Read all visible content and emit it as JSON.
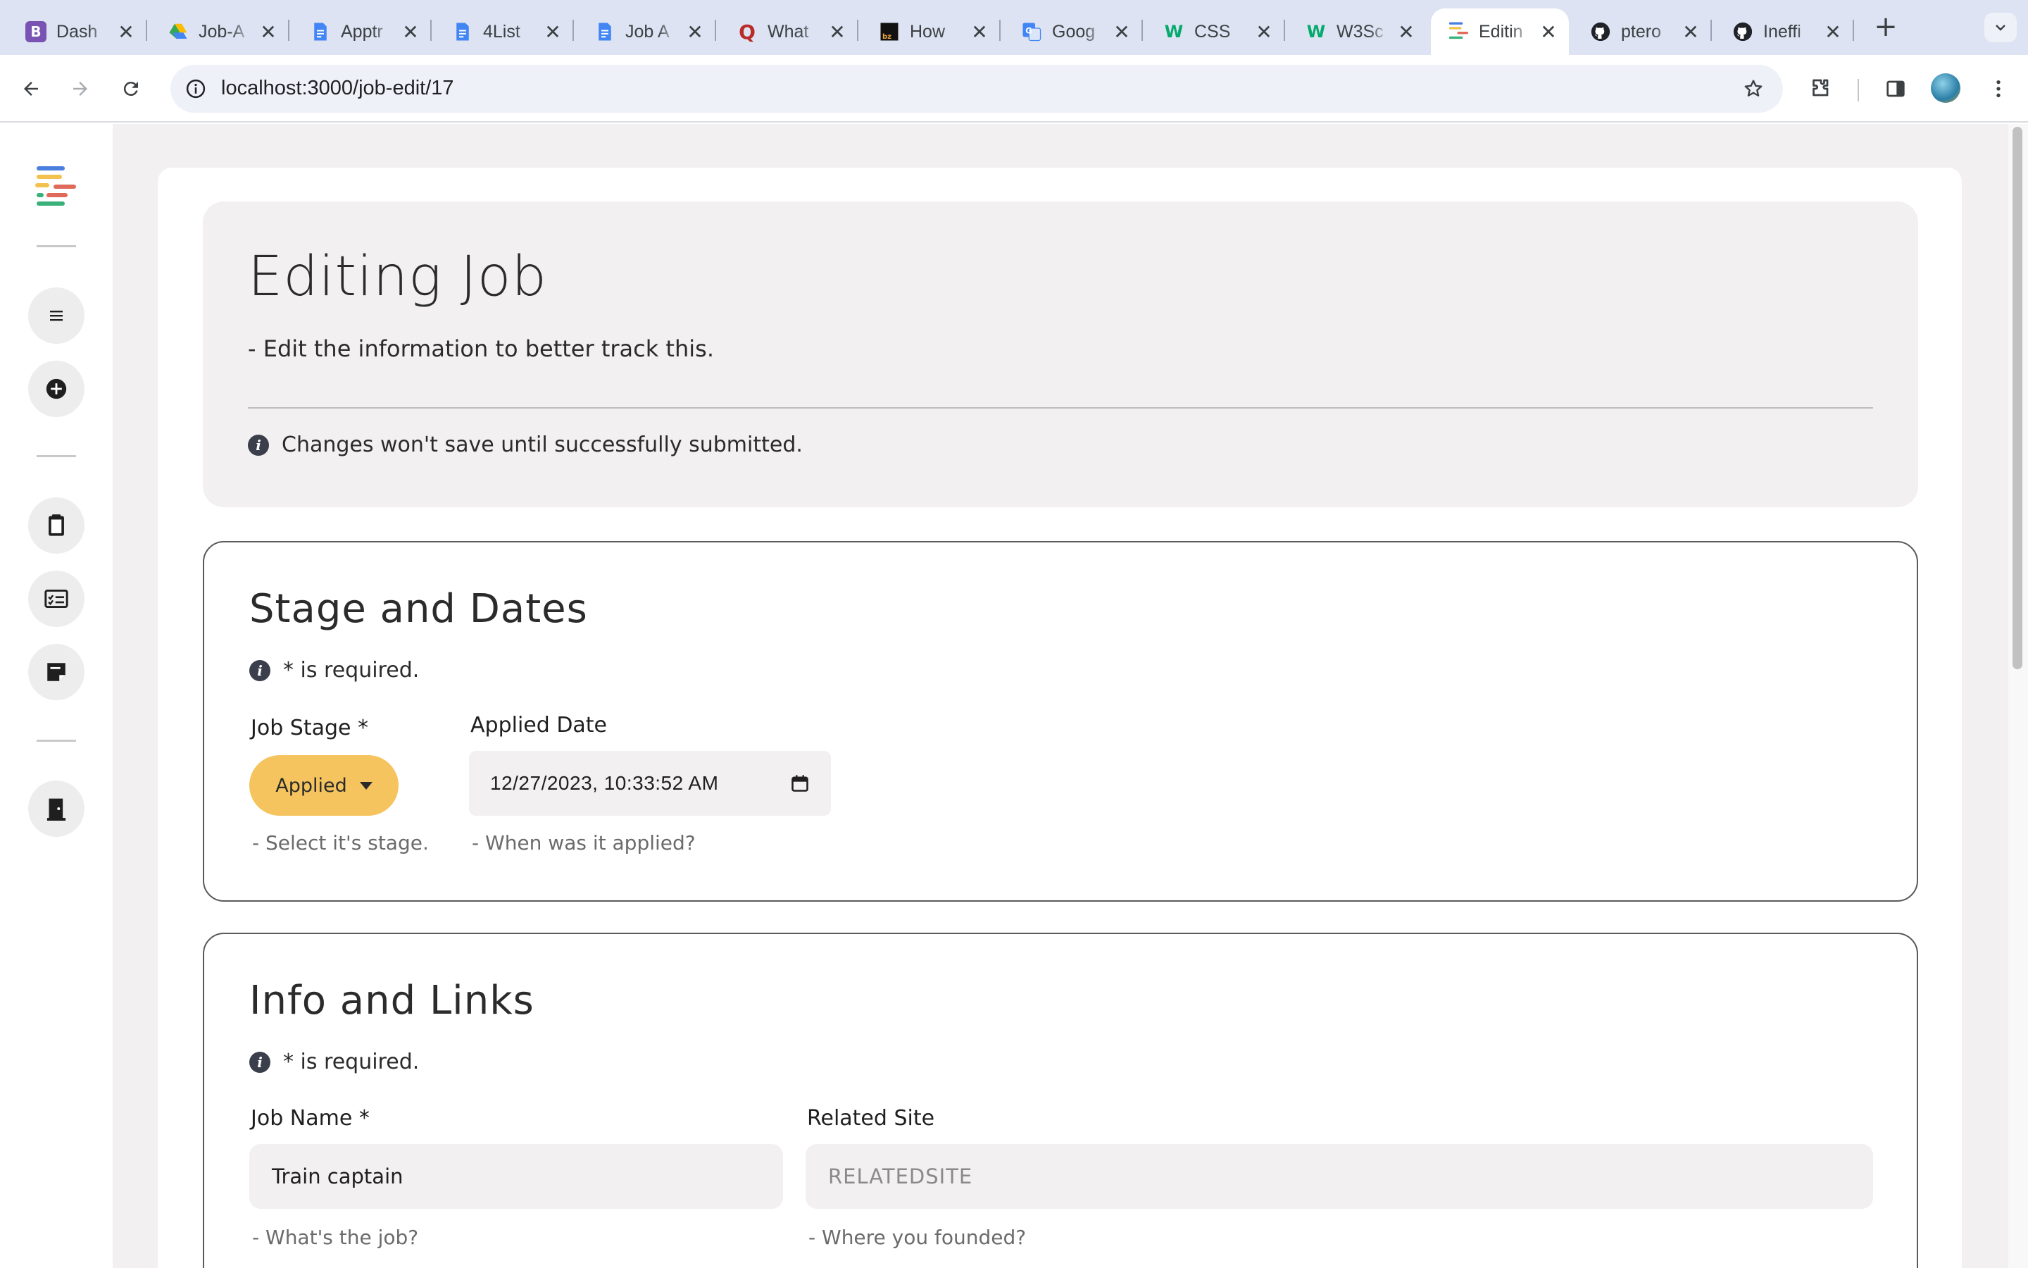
{
  "browser": {
    "tabs": [
      {
        "title": "Dash",
        "favicon": "bootstrap-icon",
        "color": "#7952b3",
        "glyph": "B"
      },
      {
        "title": "Job-A",
        "favicon": "google-drive-icon",
        "color": "#ffffff",
        "glyph": ""
      },
      {
        "title": "Apptr",
        "favicon": "google-docs-icon",
        "color": "#4285f4",
        "glyph": ""
      },
      {
        "title": "4List",
        "favicon": "google-docs-icon",
        "color": "#4285f4",
        "glyph": ""
      },
      {
        "title": "Job A",
        "favicon": "google-docs-icon",
        "color": "#4285f4",
        "glyph": ""
      },
      {
        "title": "What",
        "favicon": "quora-icon",
        "color": "#b92b27",
        "glyph": "Q"
      },
      {
        "title": "How",
        "favicon": "bytes-icon",
        "color": "#111111",
        "glyph": ""
      },
      {
        "title": "Goog",
        "favicon": "google-translate-icon",
        "color": "#4285f4",
        "glyph": "G"
      },
      {
        "title": "CSS",
        "favicon": "w3schools-icon",
        "color": "#04aa6d",
        "glyph": "W"
      },
      {
        "title": "W3Sc",
        "favicon": "w3schools-icon",
        "color": "#04aa6d",
        "glyph": "W"
      },
      {
        "title": "Editin",
        "favicon": "app-logo-icon",
        "color": "#ffffff",
        "glyph": ""
      },
      {
        "title": "ptero",
        "favicon": "github-icon",
        "color": "#ffffff",
        "glyph": ""
      },
      {
        "title": "Ineffi",
        "favicon": "github-icon",
        "color": "#ffffff",
        "glyph": ""
      }
    ],
    "active_tab_index": 10,
    "url": "localhost:3000/job-edit/17",
    "tab_close_glyph": "✕",
    "new_tab_glyph": "+"
  },
  "sidebar": {
    "items": [
      {
        "name": "sidebar-item-list",
        "icon": "list-icon"
      },
      {
        "name": "sidebar-item-add",
        "icon": "add-circle-icon"
      },
      {
        "name": "sidebar-item-clipboard",
        "icon": "clipboard-icon"
      },
      {
        "name": "sidebar-item-form",
        "icon": "form-card-icon"
      },
      {
        "name": "sidebar-item-notes",
        "icon": "sticky-note-icon"
      },
      {
        "name": "sidebar-item-logout",
        "icon": "door-exit-icon"
      }
    ]
  },
  "header": {
    "title": "Editing Job",
    "subtitle": "- Edit the information to better track this.",
    "notice": "Changes won't save until successfully submitted."
  },
  "stage_section": {
    "title": "Stage and Dates",
    "required_note": "* is required.",
    "job_stage": {
      "label": "Job Stage *",
      "value": "Applied",
      "hint": "- Select it's stage."
    },
    "applied_date": {
      "label": "Applied Date",
      "value": "12/27/2023, 10:33:52 AM",
      "hint": "- When was it applied?"
    }
  },
  "info_section": {
    "title": "Info and Links",
    "required_note": "* is required.",
    "job_name": {
      "label": "Job Name *",
      "value": "Train captain",
      "hint": "- What's the job?"
    },
    "related_site": {
      "label": "Related Site",
      "placeholder": "RELATEDSITE",
      "hint": "- Where you founded?"
    }
  },
  "colors": {
    "stage_button": "#f5c45e",
    "page_background": "#f2f0f0",
    "tabstrip": "#dde3f2"
  }
}
